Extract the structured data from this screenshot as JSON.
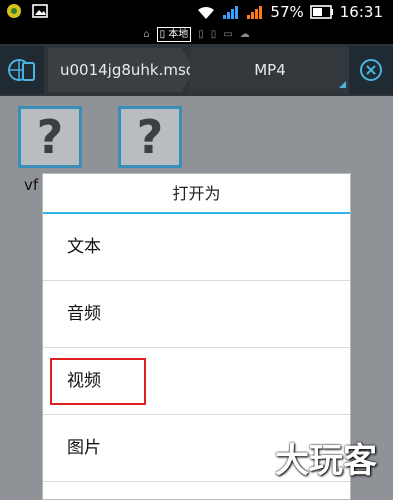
{
  "status_bar": {
    "battery": "57%",
    "time": "16:31"
  },
  "storage": {
    "active_label": "本地"
  },
  "path": {
    "crumb1": "u0014jg8uhk.msd",
    "crumb2": "MP4"
  },
  "files": [
    {
      "icon": "?",
      "label": "vf"
    },
    {
      "icon": "?",
      "label": ""
    }
  ],
  "dialog": {
    "title": "打开为",
    "items": [
      "文本",
      "音频",
      "视频",
      "图片"
    ]
  },
  "watermark": {
    "text": "大玩客"
  },
  "colors": {
    "accent": "#33b5e5",
    "highlight": "#e02020",
    "pathbar": "#2e3337"
  }
}
